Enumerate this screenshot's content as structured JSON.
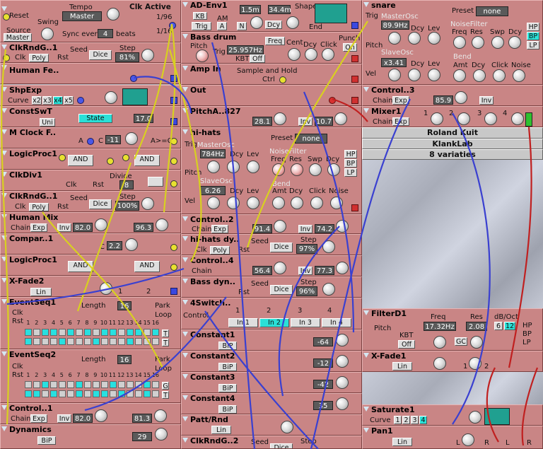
{
  "modules": {
    "clock": {
      "title": "Clk Active",
      "tempo_label": "Tempo",
      "tempo_value": "Master",
      "reset": "Reset",
      "swing": "Swing",
      "source": "Source",
      "source_value": "Master",
      "sync_label": "Sync every",
      "sync_value": "4",
      "beats": "beats",
      "ratio1": "1/96",
      "ratio2": "1/16"
    },
    "clkrnd1": {
      "title": "ClkRndG..1",
      "seed_label": "Seed",
      "step_label": "Step",
      "clk": "Clk",
      "poly": "Poly",
      "rst": "Rst",
      "dice": "Dice",
      "step_value": "81%"
    },
    "humanfe": {
      "title": "Human Fe.."
    },
    "shpexp": {
      "title": "ShpExp",
      "curve": "Curve",
      "x2": "x2",
      "x3": "x3",
      "x4": "x4",
      "x5": "x5"
    },
    "constswt": {
      "title": "ConstSwT",
      "state": "State",
      "uni": "Uni",
      "value": "17.0"
    },
    "mclock": {
      "title": "M Clock F..",
      "a": "A",
      "c": "C",
      "c_value": "-11",
      "cond": "A>=C"
    },
    "logic1": {
      "title": "LogicProc1",
      "op1": "AND",
      "op2": "AND"
    },
    "clkdiv": {
      "title": "ClkDiv1",
      "divide": "Divide",
      "clk": "Clk",
      "rst": "Rst",
      "value": "8"
    },
    "clkrnd2": {
      "title": "ClkRndG..1",
      "seed_label": "Seed",
      "step_label": "Step",
      "clk": "Clk",
      "poly": "Poly",
      "rst": "Rst",
      "dice": "Dice",
      "step_value": "100%"
    },
    "humanmix": {
      "title": "Human Mix",
      "chain": "Chain",
      "exp": "Exp",
      "inv": "Inv",
      "value1": "82.0",
      "value2": "96.3"
    },
    "compar": {
      "title": "Compar..1",
      "a": "A",
      "c": "C",
      "c_value": "2.2"
    },
    "logic2": {
      "title": "LogicProc1",
      "op1": "AND",
      "op2": "AND"
    },
    "xfade2": {
      "title": "X-Fade2",
      "lin": "Lin",
      "one": "1",
      "two": "2"
    },
    "evseq1": {
      "title": "EventSeq1",
      "length_label": "Length",
      "length_value": "16",
      "clk": "Clk",
      "rst": "Rst",
      "park": "Park",
      "loop": "Loop",
      "t": "T",
      "steps": [
        1,
        2,
        3,
        4,
        5,
        6,
        7,
        8,
        9,
        10,
        11,
        12,
        13,
        14,
        15,
        16
      ]
    },
    "evseq2": {
      "title": "EventSeq2",
      "length_label": "Length",
      "length_value": "16",
      "clk": "Clk",
      "rst": "Rst",
      "park": "Park",
      "loop": "Loop",
      "g": "G",
      "t": "T",
      "steps": [
        1,
        2,
        3,
        4,
        5,
        6,
        7,
        8,
        9,
        10,
        11,
        12,
        13,
        14,
        15,
        16
      ]
    },
    "control1": {
      "title": "Control..1",
      "chain": "Chain",
      "exp": "Exp",
      "inv": "Inv",
      "value1": "82.0",
      "value2": "81.3"
    },
    "dynamics": {
      "title": "Dynamics",
      "bip": "BiP",
      "value": "29"
    },
    "adenv": {
      "title": "AD-Env1",
      "kb": "KB",
      "am": "AM",
      "trig": "Trig",
      "a": "A",
      "n": "N",
      "d": "D",
      "dcy": "Dcy",
      "attack": "1.5m",
      "decay": "34.4m",
      "shape": "Shape",
      "end": "End"
    },
    "bassdrum": {
      "title": "Bass drum",
      "freq": "Freq",
      "punch": "Punch",
      "on": "On",
      "pitch": "Pitch",
      "trig": "Trig",
      "freq_value": "25.957Hz",
      "kbt": "KBT",
      "off": "Off",
      "cent": "Cent",
      "dcy": "Dcy",
      "click": "Click"
    },
    "ampin": {
      "title": "Amp In",
      "sample_hold": "Sample and Hold",
      "ctrl": "Ctrl"
    },
    "out": {
      "title": "Out"
    },
    "pitcha": {
      "title": "PitchA..827",
      "inv": "Inv",
      "value1": "28.1",
      "value2": "10.7"
    },
    "hihats": {
      "title": "hi-hats",
      "preset_label": "Preset",
      "preset_value": "none",
      "trig": "Trig",
      "masterosc": "MasterOsc",
      "freq_value": "784Hz",
      "dcy": "Dcy",
      "lev": "Lev",
      "noisefilter": "NoiseFilter",
      "freq": "Freq",
      "res": "Res",
      "swp": "Swp",
      "hp": "HP",
      "bp": "BP",
      "lp": "LP",
      "pitch": "Pitch",
      "slaveosc": "SlaveOsc",
      "slave_value": "6.26",
      "bend": "Bend",
      "amt": "Amt",
      "click": "Click",
      "noise": "Noise",
      "vel": "Vel"
    },
    "control2": {
      "title": "Control..2",
      "chain": "Chain",
      "exp": "Exp",
      "inv": "Inv",
      "value1": "91.4",
      "value2": "74.2"
    },
    "hihatsdy": {
      "title": "hi-hats dy..",
      "seed_label": "Seed",
      "step_label": "Step",
      "clk": "Clk",
      "poly": "Poly",
      "rst": "Rst",
      "dice": "Dice",
      "step_value": "97%"
    },
    "control4": {
      "title": "Control..4",
      "chain": "Chain",
      "inv": "Inv",
      "value1": "56.4",
      "value2": "77.3"
    },
    "bassdyn": {
      "title": "Bass dyn..",
      "seed_label": "Seed",
      "step_label": "Step",
      "rst": "Rst",
      "dice": "Dice",
      "step_value": "96%"
    },
    "switch": {
      "title": "4Switch..",
      "control": "Control",
      "in1": "In 1",
      "in2": "In 2",
      "in3": "In 3",
      "in4": "In 4",
      "n1": "1",
      "n2": "2",
      "n3": "3",
      "n4": "4"
    },
    "const1": {
      "title": "Constant1",
      "bip": "BiP",
      "value": "-64"
    },
    "const2": {
      "title": "Constant2",
      "bip": "BiP",
      "value": "-12"
    },
    "const3": {
      "title": "Constant3",
      "bip": "BiP",
      "value": "-42"
    },
    "const4": {
      "title": "Constant4",
      "bip": "BiP",
      "value": "35"
    },
    "pattrnd": {
      "title": "Patt/Rnd",
      "lin": "Lin"
    },
    "clkrnd3": {
      "title": "ClkRndG..2",
      "seed_label": "Seed",
      "step_label": "Step",
      "dice": "Dice"
    },
    "snare": {
      "title": "snare",
      "preset_label": "Preset",
      "preset_value": "none",
      "trig": "Trig",
      "masterosc": "MasterOsc",
      "freq_value": "89.9Hz",
      "dcy": "Dcy",
      "lev": "Lev",
      "noisefilter": "NoiseFilter",
      "freq": "Freq",
      "res": "Res",
      "swp": "Swp",
      "hp": "HP",
      "bp": "BP",
      "lp": "LP",
      "pitch": "Pitch",
      "slaveosc": "SlaveOsc",
      "slave_value": "x3.41",
      "bend": "Bend",
      "amt": "Amt",
      "click": "Click",
      "noise": "Noise",
      "vel": "Vel"
    },
    "control3": {
      "title": "Control..3",
      "chain": "Chain",
      "exp": "Exp",
      "inv": "Inv",
      "value": "85.9"
    },
    "mixer": {
      "title": "Mixer1",
      "chain": "Chain",
      "exp": "Exp",
      "n1": "1",
      "n2": "2",
      "n3": "3",
      "n4": "4"
    },
    "filterd": {
      "title": "FilterD1",
      "freq_label": "Freq",
      "res_label": "Res",
      "db_label": "dB/Oct",
      "pitch": "Pitch",
      "kbt": "KBT",
      "off": "Off",
      "freq_value": "17.32Hz",
      "res_value": "2.08",
      "db6": "6",
      "db12": "12",
      "gc": "GC",
      "hp": "HP",
      "bp": "BP",
      "lp": "LP"
    },
    "xfade1": {
      "title": "X-Fade1",
      "lin": "Lin",
      "one": "1",
      "two": "2"
    },
    "saturate": {
      "title": "Saturate1",
      "curve": "Curve",
      "c1": "1",
      "c2": "2",
      "c3": "3",
      "c4": "4"
    },
    "pan": {
      "title": "Pan1",
      "lin": "Lin",
      "l": "L",
      "r": "R"
    }
  },
  "patch_list": [
    "Roland Kuit",
    "KlankLab",
    "8 variaties"
  ],
  "colors": {
    "module_bg": "#c98585",
    "cable_yellow": "#d8d020",
    "cable_blue": "#3a40d0",
    "cable_red": "#c02020",
    "accent_cyan": "#2ae0d7"
  }
}
